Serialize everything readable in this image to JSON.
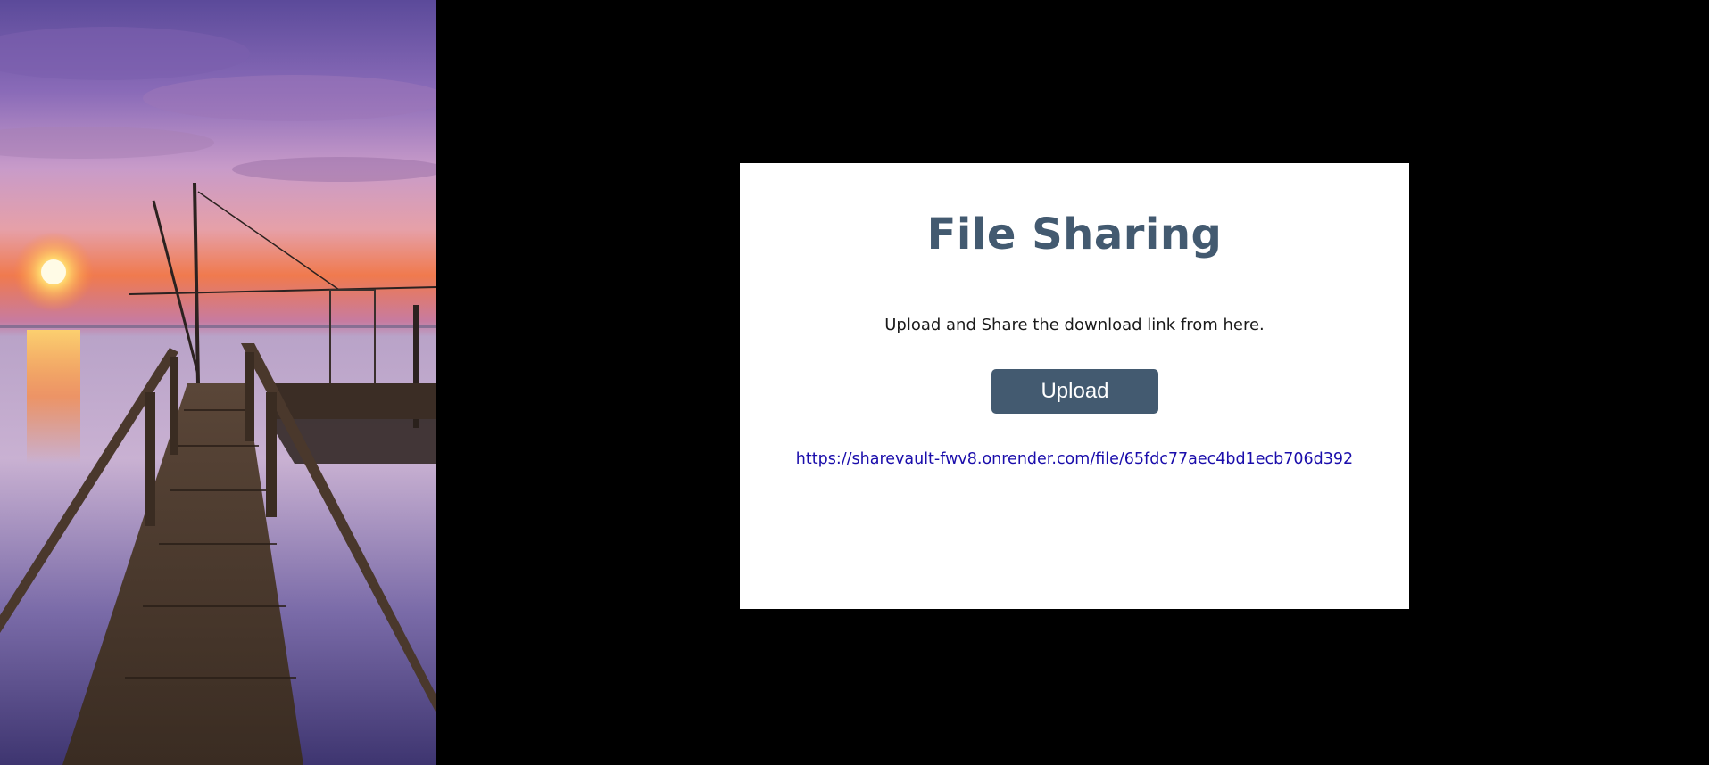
{
  "background": {
    "photo_description_icon": "sunset-pier-photo",
    "page_color": "#000000"
  },
  "card": {
    "title": "File Sharing",
    "subtitle": "Upload and Share the download link from here.",
    "upload_button_label": "Upload",
    "share_link": "https://sharevault-fwv8.onrender.com/file/65fdc77aec4bd1ecb706d392",
    "accent_color": "#435a70",
    "link_color": "#1a0dab"
  }
}
